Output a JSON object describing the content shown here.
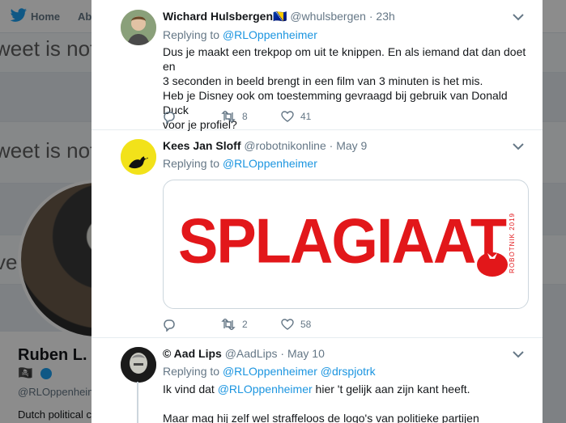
{
  "background": {
    "nav": {
      "home": "Home",
      "about": "Ab"
    },
    "band_text": "weet is not",
    "band_text_2": "weet is not",
    "band_text_3": "ve",
    "profile_name": "Ruben L. O",
    "profile_emoji": "🏴‍☠️",
    "profile_handle": "@RLOppenheim",
    "profile_bio": "Dutch political c"
  },
  "tweets": [
    {
      "name": "Wichard Hulsbergen🇧🇦",
      "handle": "@whulsbergen",
      "dot": "·",
      "time": "23h",
      "replying_prefix": "Replying to",
      "replying_mention": "@RLOppenheimer",
      "lines": [
        "Dus je maakt een trekpop om uit te knippen. En als iemand dat dan doet en",
        "3 seconden in beeld brengt in een film van 3 minuten is het mis.",
        "Heb je Disney ook om toestemming gevraagd bij gebruik van Donald Duck",
        "voor je profiel?"
      ],
      "retweets": "8",
      "likes": "41"
    },
    {
      "name": "Kees Jan Sloff",
      "handle": "@robotnikonline",
      "dot": "·",
      "time": "May 9",
      "replying_prefix": "Replying to",
      "replying_mention": "@RLOppenheimer",
      "avatar_label": "robotnik",
      "media_text": "SPLAGIAAT",
      "media_vertical": "ROBOTNIK 2019",
      "retweets": "2",
      "likes": "58"
    },
    {
      "name": "© Aad Lips",
      "handle": "@AadLips",
      "dot": "·",
      "time": "May 10",
      "replying_prefix": "Replying to",
      "replying_mention": "@RLOppenheimer",
      "replying_mention_2": "@drspjotrk",
      "line1_pre": "Ik vind dat",
      "line1_mention": "@RLOppenheimer",
      "line1_post": "hier 't gelijk aan zijn kant heeft.",
      "line2": "Maar mag hij zelf wel straffeloos de logo's van politieke partijen gebruiken?"
    }
  ],
  "colors": {
    "accent": "#1b95e0",
    "splagiaat_red": "#e2171a"
  }
}
